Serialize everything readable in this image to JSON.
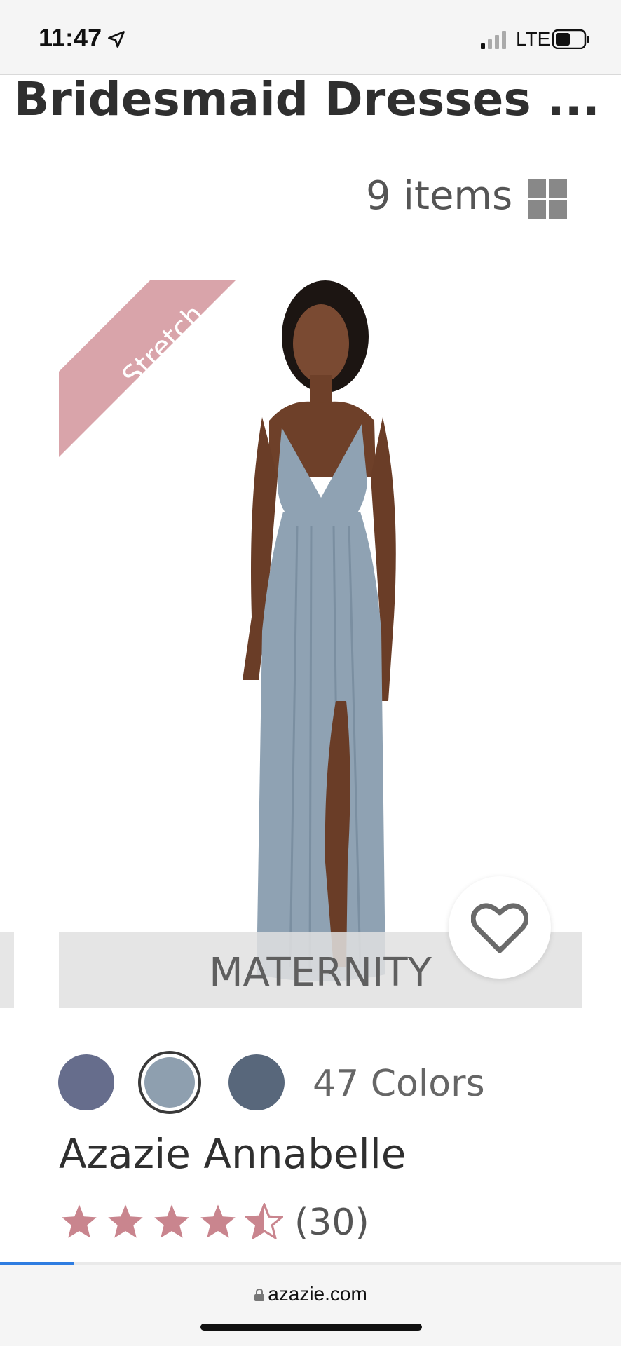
{
  "status_bar": {
    "time": "11:47",
    "network": "LTE"
  },
  "page": {
    "title": "Bridesmaid Dresses ...",
    "items_count": "9 items"
  },
  "product": {
    "ribbon": "Stretch",
    "badge": "MATERNITY",
    "swatch_colors": [
      "#666d8c",
      "#8e9faf",
      "#58677b"
    ],
    "colors_count": "47 Colors",
    "name": "Azazie Annabelle",
    "rating_stars": 4.5,
    "review_count": "(30)"
  },
  "browser": {
    "url": "azazie.com",
    "load_progress": 0.12
  },
  "colors": {
    "ribbon": "#d9a4aa",
    "star": "#c9858e",
    "dress": "#8fa2b3"
  }
}
